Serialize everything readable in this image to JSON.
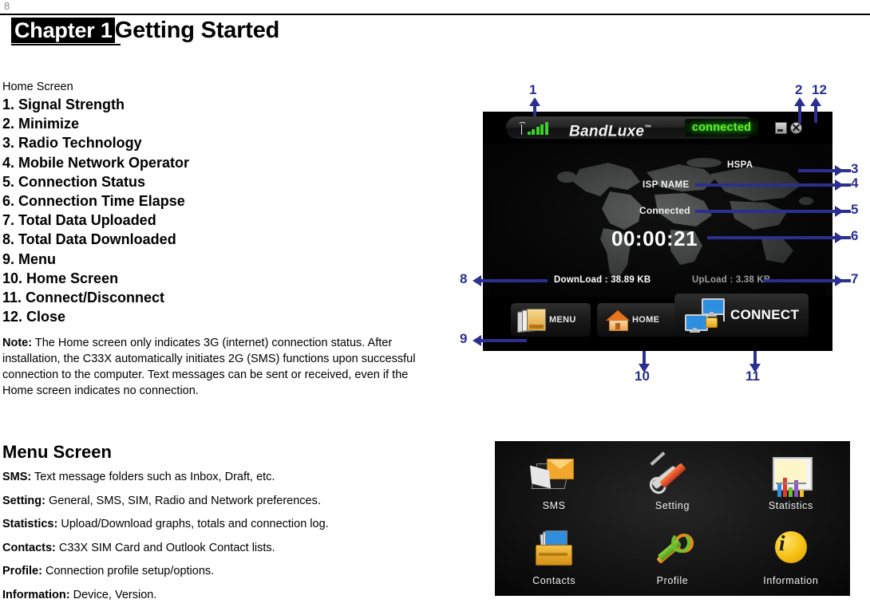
{
  "header": {
    "page_number": "8",
    "chapter_tag": "Chapter 1",
    "chapter_title": "Getting Started"
  },
  "home_screen_section": {
    "label": "Home Screen",
    "items": [
      "1. Signal Strength",
      "2. Minimize",
      "3. Radio Technology",
      "4. Mobile Network Operator",
      "5. Connection Status",
      "6. Connection Time Elapse",
      "7. Total Data Uploaded",
      "8. Total Data Downloaded",
      "9. Menu",
      "10. Home Screen",
      "11. Connect/Disconnect",
      "12. Close"
    ],
    "note_label": "Note:",
    "note_text": "The Home screen only indicates 3G (internet) connection status. After installation, the C33X automatically initiates 2G (SMS) functions upon successful connection to the computer. Text messages can be sent or received, even if the Home screen indicates no connection."
  },
  "menu_screen_section": {
    "heading": "Menu Screen",
    "entries": [
      {
        "term": "SMS:",
        "desc": "Text message folders such as Inbox, Draft, etc."
      },
      {
        "term": "Setting:",
        "desc": "General, SMS, SIM, Radio and Network preferences."
      },
      {
        "term": "Statistics:",
        "desc": "Upload/Download graphs, totals and connection log."
      },
      {
        "term": "Contacts:",
        "desc": "C33X SIM Card and Outlook Contact lists."
      },
      {
        "term": "Profile:",
        "desc": "Connection profile setup/options."
      },
      {
        "term": "Information:",
        "desc": "Device, Version."
      }
    ]
  },
  "device_home": {
    "brand": "BandLuxe",
    "brand_tm": "™",
    "status_pill": "connected",
    "radio_technology": "HSPA",
    "operator": "ISP NAME",
    "connection_status": "Connected",
    "timer": "00:00:21",
    "download": "DownLoad : 38.89 KB",
    "upload": "UpLoad : 3.38 KB",
    "buttons": {
      "menu": "MENU",
      "home": "HOME",
      "connect": "CONNECT"
    },
    "colors": {
      "accent_green": "#5cf22e",
      "signal_green": "#39d12a",
      "callout_blue": "#2b2f8f",
      "window_black": "#050505"
    }
  },
  "device_menu": {
    "tiles": [
      {
        "icon": "sms-icon",
        "label": "SMS"
      },
      {
        "icon": "setting-icon",
        "label": "Setting"
      },
      {
        "icon": "statistics-icon",
        "label": "Statistics"
      },
      {
        "icon": "contacts-icon",
        "label": "Contacts"
      },
      {
        "icon": "profile-icon",
        "label": "Profile"
      },
      {
        "icon": "information-icon",
        "label": "Information"
      }
    ]
  },
  "callouts": [
    {
      "n": "1"
    },
    {
      "n": "2"
    },
    {
      "n": "12"
    },
    {
      "n": "3"
    },
    {
      "n": "4"
    },
    {
      "n": "5"
    },
    {
      "n": "6"
    },
    {
      "n": "7"
    },
    {
      "n": "8"
    },
    {
      "n": "9"
    },
    {
      "n": "10"
    },
    {
      "n": "11"
    }
  ]
}
